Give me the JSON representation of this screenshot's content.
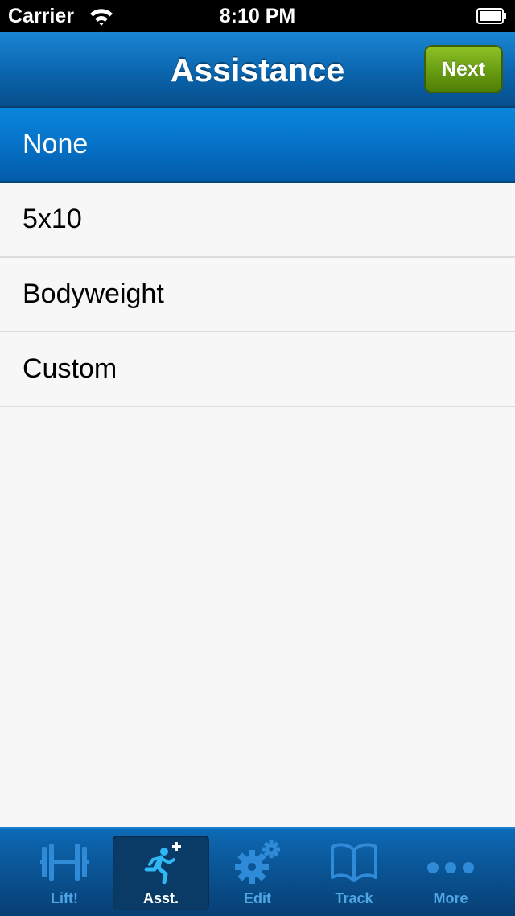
{
  "status_bar": {
    "carrier": "Carrier",
    "time": "8:10 PM"
  },
  "nav": {
    "title": "Assistance",
    "next_label": "Next"
  },
  "list": {
    "items": [
      {
        "label": "None",
        "selected": true
      },
      {
        "label": "5x10",
        "selected": false
      },
      {
        "label": "Bodyweight",
        "selected": false
      },
      {
        "label": "Custom",
        "selected": false
      }
    ]
  },
  "tabs": [
    {
      "label": "Lift!",
      "icon": "barbell-icon",
      "active": false
    },
    {
      "label": "Asst.",
      "icon": "runner-plus-icon",
      "active": true
    },
    {
      "label": "Edit",
      "icon": "gears-icon",
      "active": false
    },
    {
      "label": "Track",
      "icon": "open-book-icon",
      "active": false
    },
    {
      "label": "More",
      "icon": "more-dots-icon",
      "active": false
    }
  ],
  "colors": {
    "nav_blue": "#0a64ad",
    "selected_row": "#0572c8",
    "next_green": "#6a9f13",
    "tab_icon_blue": "#2f8ad8",
    "active_tab_icon": "#2fb8f5"
  }
}
